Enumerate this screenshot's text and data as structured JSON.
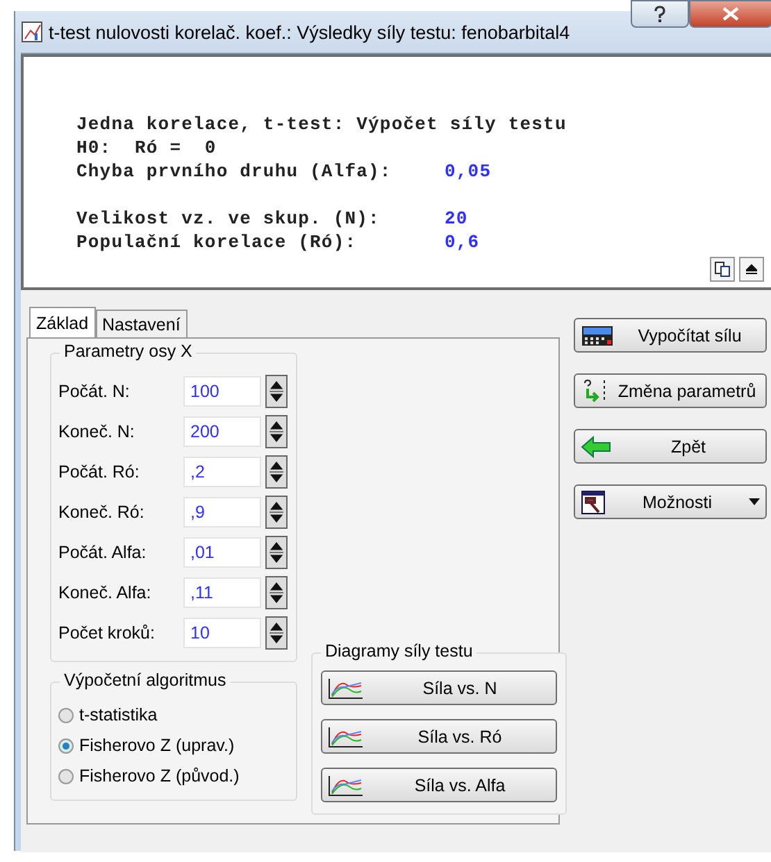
{
  "window": {
    "title": "t-test nulovosti korelač. koef.: Výsledky síly testu: fenobarbital4"
  },
  "report": {
    "lines": [
      {
        "label": "Jedna korelace, t-test: Výpočet síly testu"
      },
      {
        "label": "H0:  Ró =  0"
      },
      {
        "label": "Chyba prvního druhu (Alfa):",
        "value": "0,05"
      },
      {
        "label": "Velikost vz. ve skup. (N):",
        "value": "20",
        "gap_before": true
      },
      {
        "label": "Populační korelace (Ró):",
        "value": "0,6"
      }
    ]
  },
  "tabs": [
    {
      "label": "Základ",
      "selected": true
    },
    {
      "label": "Nastavení",
      "selected": false
    }
  ],
  "x_axis_group": {
    "title": "Parametry osy X",
    "fields": [
      {
        "label": "Počát. N:",
        "value": "100"
      },
      {
        "label": "Koneč. N:",
        "value": "200"
      },
      {
        "label": "Počát. Ró:",
        "value": ",2"
      },
      {
        "label": "Koneč. Ró:",
        "value": ",9"
      },
      {
        "label": "Počát. Alfa:",
        "value": ",01"
      },
      {
        "label": "Koneč. Alfa:",
        "value": ",11"
      },
      {
        "label": "Počet kroků:",
        "value": "10"
      }
    ]
  },
  "algorithm_group": {
    "title": "Výpočetní algoritmus",
    "options": [
      {
        "label": "t-statistika",
        "selected": false
      },
      {
        "label": "Fisherovo Z (uprav.)",
        "selected": true
      },
      {
        "label": "Fisherovo Z (původ.)",
        "selected": false
      }
    ]
  },
  "charts_group": {
    "title": "Diagramy síly testu",
    "buttons": [
      "Síla vs. N",
      "Síla vs. Ró",
      "Síla vs. Alfa"
    ]
  },
  "actions": [
    {
      "label": "Vypočítat sílu",
      "kind": "compute"
    },
    {
      "label": "Změna parametrů",
      "kind": "params"
    },
    {
      "label": "Zpět",
      "kind": "back"
    },
    {
      "label": "Možnosti",
      "kind": "menu"
    }
  ]
}
